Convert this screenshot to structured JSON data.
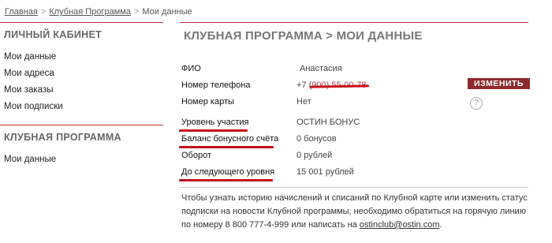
{
  "breadcrumb": {
    "items": [
      "Главная",
      "Клубная Программа"
    ],
    "separator": ">",
    "current": "Мои данные"
  },
  "sidebar": {
    "cabinet_title": "ЛИЧНЫЙ КАБИНЕТ",
    "cabinet_items": [
      "Мои данные",
      "Мои адреса",
      "Мои заказы",
      "Мои подписки"
    ],
    "club_title": "КЛУБНАЯ ПРОГРАММА",
    "club_items": [
      "Мои данные"
    ]
  },
  "main": {
    "title": "КЛУБНАЯ ПРОГРАММА > МОИ ДАННЫЕ",
    "fields": {
      "fio_label": "ФИО",
      "fio_value": "Анастасия",
      "phone_label": "Номер телефона",
      "phone_prefix": "+7 (",
      "phone_hidden": "900) 55-00-78",
      "card_label": "Номер карты",
      "card_value": "Нет",
      "level_label": "Уровень участия",
      "level_value": "ОСТИН БОНУС",
      "balance_label": "Баланс бонусного счёта",
      "balance_value": "0 бонусов",
      "turnover_label": "Оборот",
      "turnover_value": "0 рублей",
      "next_level_label": "До следующего уровня",
      "next_level_value": "15 001 рублей"
    },
    "change_button": "ИЗМЕНИТЬ",
    "help_icon": "?",
    "info_text": "Чтобы узнать историю начислений и списаний по Клубной карте или изменить статус подписки на новости Клубной программы, необходимо обратиться на горячую линию по номеру 8 800 777-4-999 или написать на",
    "info_email": "ostinclub@ostin.com",
    "info_end": "."
  },
  "colors": {
    "accent_red": "#c8121c",
    "button_bg": "#8e2a2c",
    "rule": "#b8323a"
  }
}
